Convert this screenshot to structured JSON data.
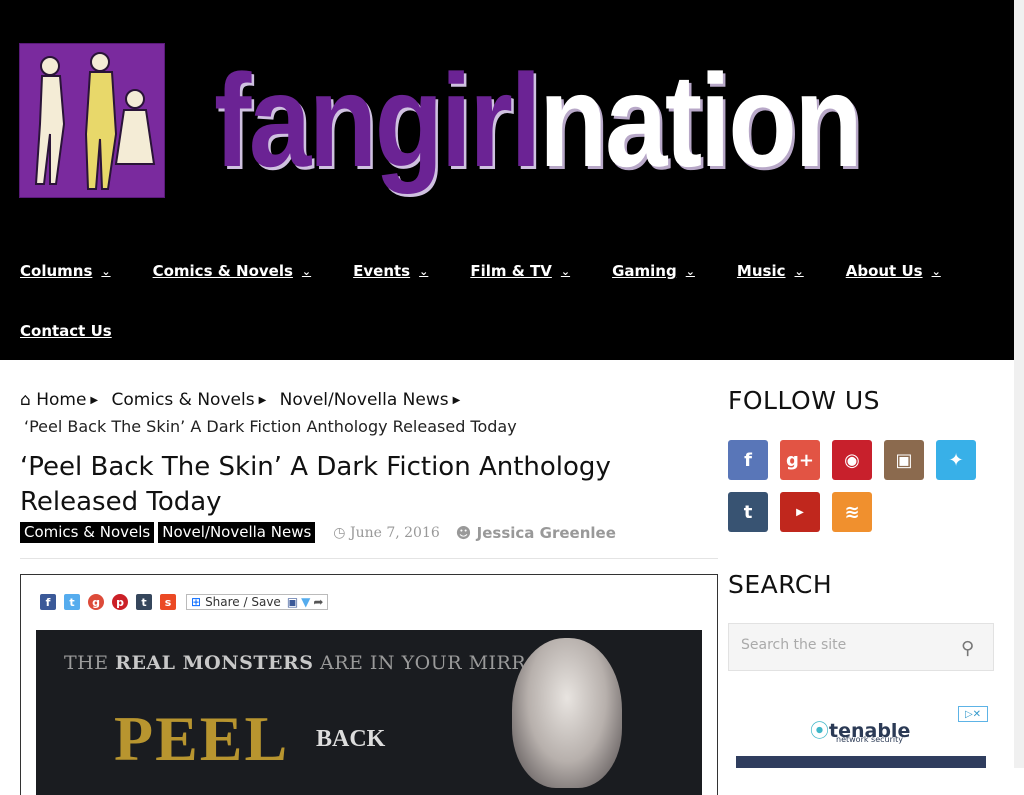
{
  "site": {
    "logo_fan": "fangirl",
    "logo_nation": "nation"
  },
  "nav": {
    "items": [
      "Columns",
      "Comics & Novels",
      "Events",
      "Film & TV",
      "Gaming",
      "Music",
      "About Us"
    ],
    "contact": "Contact Us"
  },
  "breadcrumb": {
    "home": "Home",
    "level1": "Comics & Novels",
    "level2": "Novel/Novella News",
    "current": "‘Peel Back The Skin’ A Dark Fiction Anthology Released Today"
  },
  "post": {
    "title": "‘Peel Back The Skin’ A Dark Fiction Anthology Released Today",
    "categories": [
      "Comics & Novels",
      "Novel/Novella News"
    ],
    "date": "June 7, 2016",
    "author": "Jessica Greenlee",
    "share_label": "Share / Save",
    "banner_tagline_pre": "THE ",
    "banner_tagline_bold": "REAL MONSTERS",
    "banner_tagline_post": " ARE IN YOUR MIRROR",
    "banner_peel": "PEEL",
    "banner_back": "BACK"
  },
  "sidebar": {
    "follow_heading": "FOLLOW US",
    "search_heading": "SEARCH",
    "search_placeholder": "Search the site",
    "ad_brand": "tenable",
    "ad_sub": "network security"
  },
  "colors": {
    "header_bg": "#000000",
    "logo_purple": "#6b2394",
    "facebook": "#5976b8",
    "googleplus": "#e25444",
    "pinterest": "#c8202c",
    "instagram": "#8b6a4e",
    "twitter": "#38b0e8",
    "tumblr": "#385372",
    "youtube": "#c0271d",
    "rss": "#f0902e"
  }
}
